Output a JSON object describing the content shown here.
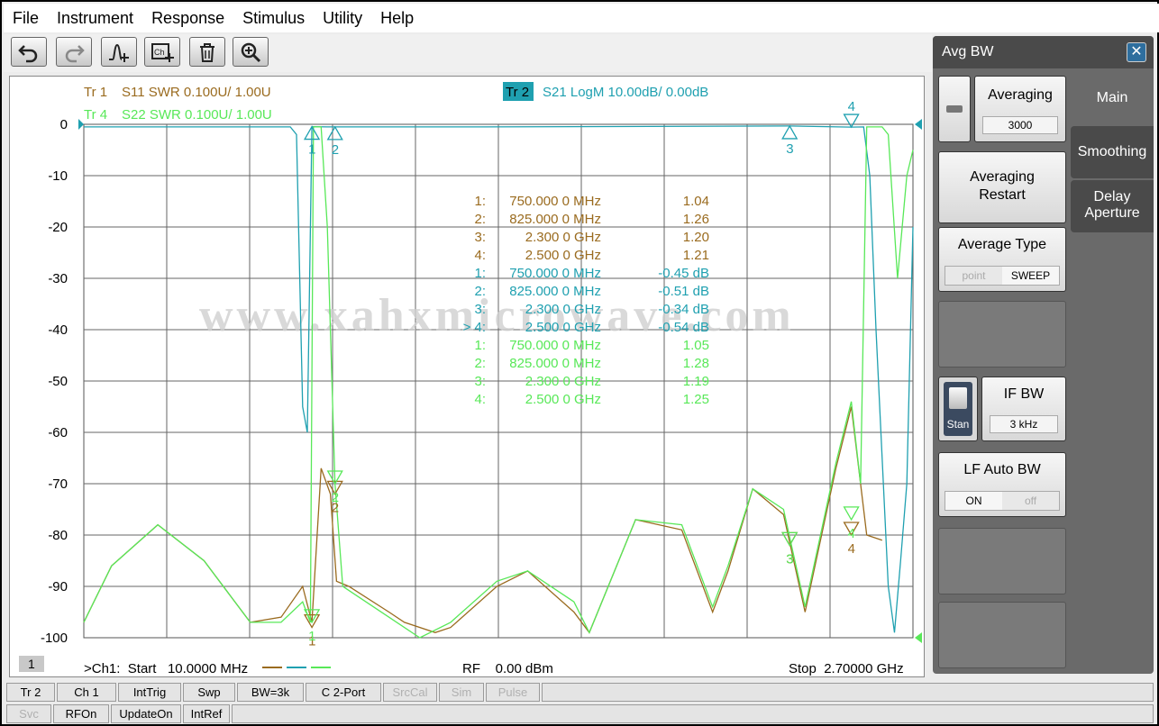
{
  "menu": [
    "File",
    "Instrument",
    "Response",
    "Stimulus",
    "Utility",
    "Help"
  ],
  "toolbar_icons": [
    "undo-icon",
    "redo-icon",
    "add-marker-icon",
    "add-channel-icon",
    "delete-icon",
    "zoom-icon"
  ],
  "traces": {
    "tr1": {
      "id": "Tr 1",
      "desc": "S11 SWR 0.100U/  1.00U",
      "color": "#9a6b1f"
    },
    "tr4": {
      "id": "Tr 4",
      "desc": "S22 SWR 0.100U/  1.00U",
      "color": "#58e858"
    },
    "tr2": {
      "id": "Tr 2",
      "desc": "S21 LogM 10.00dB/  0.00dB",
      "color": "#1fa0b0"
    }
  },
  "y_ticks": [
    "0",
    "-10",
    "-20",
    "-30",
    "-40",
    "-50",
    "-60",
    "-70",
    "-80",
    "-90",
    "-100"
  ],
  "marker_table": [
    {
      "n": "1:",
      "freq": "750.000 0 MHz",
      "val": "1.04",
      "color": "#9a6b1f"
    },
    {
      "n": "2:",
      "freq": "825.000 0 MHz",
      "val": "1.26",
      "color": "#9a6b1f"
    },
    {
      "n": "3:",
      "freq": "2.300 0 GHz",
      "val": "1.20",
      "color": "#9a6b1f"
    },
    {
      "n": "4:",
      "freq": "2.500 0 GHz",
      "val": "1.21",
      "color": "#9a6b1f"
    },
    {
      "n": "1:",
      "freq": "750.000 0 MHz",
      "val": "-0.45 dB",
      "color": "#1fa0b0"
    },
    {
      "n": "2:",
      "freq": "825.000 0 MHz",
      "val": "-0.51 dB",
      "color": "#1fa0b0"
    },
    {
      "n": "3:",
      "freq": "2.300 0 GHz",
      "val": "-0.34 dB",
      "color": "#1fa0b0"
    },
    {
      "n": "> 4:",
      "freq": "2.500 0 GHz",
      "val": "-0.54 dB",
      "color": "#1fa0b0"
    },
    {
      "n": "1:",
      "freq": "750.000 0 MHz",
      "val": "1.05",
      "color": "#58e858"
    },
    {
      "n": "2:",
      "freq": "825.000 0 MHz",
      "val": "1.28",
      "color": "#58e858"
    },
    {
      "n": "3:",
      "freq": "2.300 0 GHz",
      "val": "1.19",
      "color": "#58e858"
    },
    {
      "n": "4:",
      "freq": "2.500 0 GHz",
      "val": "1.25",
      "color": "#58e858"
    }
  ],
  "watermark": "www.xahxmicrowave.com",
  "channel_label": "1",
  "footer": {
    "start": ">Ch1:  Start   10.0000 MHz",
    "rf": "RF    0.00 dBm",
    "stop": "Stop  2.70000 GHz"
  },
  "softkeys_row1": [
    {
      "label": "Tr 2",
      "dim": false
    },
    {
      "label": "Ch 1",
      "dim": false
    },
    {
      "label": "IntTrig",
      "dim": false
    },
    {
      "label": "Swp",
      "dim": false
    },
    {
      "label": "BW=3k",
      "dim": false
    },
    {
      "label": "C  2-Port",
      "dim": false
    },
    {
      "label": "SrcCal",
      "dim": true
    },
    {
      "label": "Sim",
      "dim": true
    },
    {
      "label": "Pulse",
      "dim": true
    }
  ],
  "softkeys_row2": [
    {
      "label": "Svc",
      "dim": true
    },
    {
      "label": "RFOn",
      "dim": false
    },
    {
      "label": "UpdateOn",
      "dim": false
    },
    {
      "label": "IntRef",
      "dim": false
    }
  ],
  "panel": {
    "title": "Avg BW",
    "close": "✕",
    "tabs": [
      "Main",
      "Smoothing",
      "Delay\nAperture"
    ],
    "averaging": {
      "label": "Averaging",
      "value": "3000"
    },
    "averaging_restart": "Averaging\nRestart",
    "average_type": {
      "label": "Average Type",
      "opt1": "point",
      "opt2": "SWEEP"
    },
    "if_bw": {
      "label": "IF BW",
      "value": "3 kHz",
      "mode": "Stan"
    },
    "lf_auto_bw": {
      "label": "LF Auto BW",
      "opt1": "ON",
      "opt2": "off"
    }
  },
  "chart_data": {
    "type": "line",
    "x_range_ghz": [
      0.01,
      2.7
    ],
    "ylim": [
      -100,
      0
    ],
    "y_unit": "dB",
    "grid": true,
    "series": [
      {
        "name": "Tr 2",
        "color": "#1fa0b0",
        "points": [
          [
            0.01,
            -0.5
          ],
          [
            0.68,
            -0.5
          ],
          [
            0.7,
            -2
          ],
          [
            0.72,
            -55
          ],
          [
            0.735,
            -60
          ],
          [
            0.75,
            -0.45
          ],
          [
            0.8,
            -0.5
          ],
          [
            0.825,
            -0.51
          ],
          [
            1.3,
            -0.5
          ],
          [
            2.3,
            -0.34
          ],
          [
            2.5,
            -0.54
          ],
          [
            2.54,
            -0.5
          ],
          [
            2.56,
            -10
          ],
          [
            2.58,
            -40
          ],
          [
            2.6,
            -65
          ],
          [
            2.62,
            -90
          ],
          [
            2.64,
            -99
          ],
          [
            2.66,
            -85
          ],
          [
            2.68,
            -70
          ],
          [
            2.7,
            -20
          ]
        ]
      },
      {
        "name": "Tr 1",
        "color": "#9a6b1f",
        "points": [
          [
            0.01,
            -97
          ],
          [
            0.1,
            -86
          ],
          [
            0.25,
            -78
          ],
          [
            0.4,
            -85
          ],
          [
            0.55,
            -97
          ],
          [
            0.65,
            -96
          ],
          [
            0.72,
            -90
          ],
          [
            0.75,
            -97
          ],
          [
            0.78,
            -67
          ],
          [
            0.81,
            -72
          ],
          [
            0.83,
            -89
          ],
          [
            0.87,
            -90
          ],
          [
            1.0,
            -95
          ],
          [
            1.05,
            -97
          ],
          [
            1.15,
            -99
          ],
          [
            1.2,
            -98
          ],
          [
            1.35,
            -90
          ],
          [
            1.45,
            -87
          ],
          [
            1.6,
            -95
          ],
          [
            1.65,
            -99
          ],
          [
            1.8,
            -77
          ],
          [
            1.95,
            -79
          ],
          [
            2.05,
            -95
          ],
          [
            2.1,
            -87
          ],
          [
            2.18,
            -71
          ],
          [
            2.28,
            -76
          ],
          [
            2.35,
            -95
          ],
          [
            2.45,
            -67
          ],
          [
            2.5,
            -55
          ],
          [
            2.55,
            -80
          ],
          [
            2.6,
            -81
          ]
        ]
      },
      {
        "name": "Tr 4",
        "color": "#58e858",
        "points": [
          [
            0.01,
            -97
          ],
          [
            0.1,
            -86
          ],
          [
            0.25,
            -78
          ],
          [
            0.4,
            -85
          ],
          [
            0.55,
            -97
          ],
          [
            0.65,
            -97
          ],
          [
            0.72,
            -93
          ],
          [
            0.745,
            -97
          ],
          [
            0.755,
            -0.5
          ],
          [
            0.78,
            -0.5
          ],
          [
            0.8,
            -20
          ],
          [
            0.825,
            -70
          ],
          [
            0.85,
            -90
          ],
          [
            1.0,
            -96
          ],
          [
            1.1,
            -100
          ],
          [
            1.2,
            -97
          ],
          [
            1.35,
            -89
          ],
          [
            1.45,
            -87
          ],
          [
            1.6,
            -93
          ],
          [
            1.65,
            -99
          ],
          [
            1.8,
            -77
          ],
          [
            1.95,
            -78
          ],
          [
            2.05,
            -94
          ],
          [
            2.1,
            -86
          ],
          [
            2.18,
            -71
          ],
          [
            2.28,
            -75
          ],
          [
            2.35,
            -94
          ],
          [
            2.45,
            -66
          ],
          [
            2.5,
            -54
          ],
          [
            2.53,
            -70
          ],
          [
            2.55,
            -0.5
          ],
          [
            2.6,
            -0.5
          ],
          [
            2.62,
            -2
          ],
          [
            2.65,
            -30
          ],
          [
            2.68,
            -10
          ],
          [
            2.7,
            -5
          ]
        ]
      }
    ],
    "markers": [
      {
        "series": "Tr 2",
        "n": "1",
        "x": 0.75,
        "y": -0.45
      },
      {
        "series": "Tr 2",
        "n": "2",
        "x": 0.825,
        "y": -0.51
      },
      {
        "series": "Tr 2",
        "n": "3",
        "x": 2.3,
        "y": -0.34
      },
      {
        "series": "Tr 2",
        "n": "4",
        "x": 2.5,
        "y": -0.54
      },
      {
        "series": "Tr 1",
        "n": "1",
        "x": 0.75,
        "y": -98
      },
      {
        "series": "Tr 1",
        "n": "2",
        "x": 0.825,
        "y": -72
      },
      {
        "series": "Tr 1",
        "n": "3",
        "x": 2.3,
        "y": -82
      },
      {
        "series": "Tr 1",
        "n": "4",
        "x": 2.5,
        "y": -80
      },
      {
        "series": "Tr 4",
        "n": "1",
        "x": 0.75,
        "y": -97
      },
      {
        "series": "Tr 4",
        "n": "2",
        "x": 0.825,
        "y": -70
      },
      {
        "series": "Tr 4",
        "n": "3",
        "x": 2.3,
        "y": -82
      },
      {
        "series": "Tr 4",
        "n": "4",
        "x": 2.5,
        "y": -77
      }
    ]
  }
}
